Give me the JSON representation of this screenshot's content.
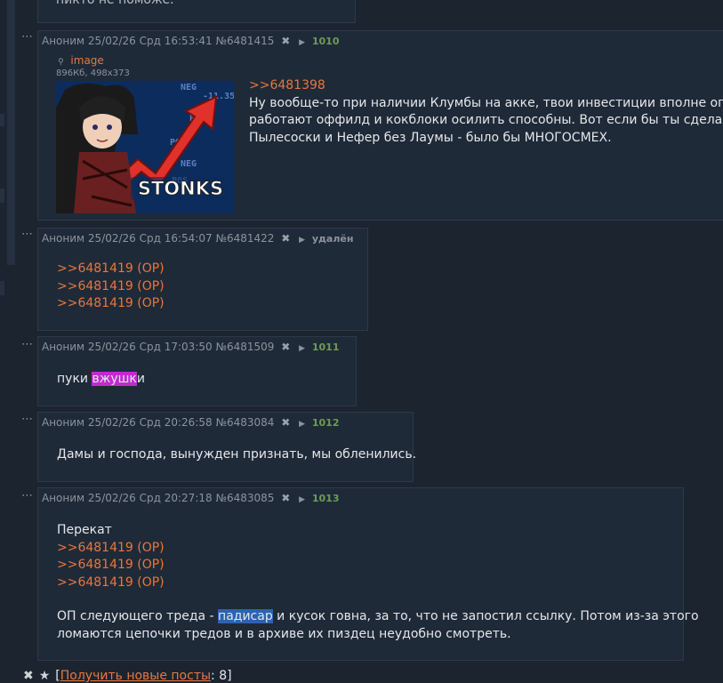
{
  "top_fragment": "пикто не поможе.",
  "posts": [
    {
      "header": {
        "name": "Аноним",
        "date": "25/02/26 Срд 16:53:41",
        "id": "№6481415",
        "counter": "1010"
      },
      "file": {
        "label": "image",
        "size": "896Кб, 498x373",
        "thumb_caption": "STONKS"
      },
      "lines": [
        "Ну вообще-то при наличии Клумбы на акке, твои инвестиции вполне оправд",
        "работают оффилд и кокблоки осилить способны. Вот если бы ты сделал нас",
        "Пылесоски и Нефер без Лаумы - было бы МНОГОСМЕХ."
      ],
      "reply_link": ">>6481398"
    },
    {
      "header": {
        "name": "Аноним",
        "date": "25/02/26 Срд 16:54:07",
        "id": "№6481422",
        "counter": "удалён"
      },
      "links": [
        ">>6481419 (OP)",
        ">>6481419 (OP)",
        ">>6481419 (OP)"
      ]
    },
    {
      "header": {
        "name": "Аноним",
        "date": "25/02/26 Срд 17:03:50",
        "id": "№6481509",
        "counter": "1011"
      },
      "text_pre": "пуки ",
      "text_hl": "вжушк",
      "text_post": "и"
    },
    {
      "header": {
        "name": "Аноним",
        "date": "25/02/26 Срд 20:26:58",
        "id": "№6483084",
        "counter": "1012"
      },
      "text": "Дамы и господа, вынужден признать, мы обленились."
    },
    {
      "header": {
        "name": "Аноним",
        "date": "25/02/26 Срд 20:27:18",
        "id": "№6483085",
        "counter": "1013"
      },
      "first_line": "Перекат",
      "links": [
        ">>6481419 (OP)",
        ">>6481419 (OP)",
        ">>6481419 (OP)"
      ],
      "op_pre": "ОП следующего треда - ",
      "op_hl": "падисар",
      "op_post": " и кусок говна, за то, что не запостил ссылку. Потом из-за этого",
      "op_line2": "ломаются цепочки тредов и в архиве их пиздец неудобно смотреть."
    }
  ],
  "ui": {
    "dots": "⋯",
    "close_glyph": "✖",
    "play_glyph": "▶",
    "search_glyph": "🔍"
  },
  "footer": {
    "icon1": "✖",
    "icon2": "★",
    "open": "[",
    "link": "Получить новые посты",
    "sep": ": ",
    "count": "8",
    "close": "]"
  },
  "colors": {
    "link": "#e8773c",
    "counter": "#6f9a58",
    "bg": "#1c2430",
    "post_bg": "#1f2a38"
  }
}
